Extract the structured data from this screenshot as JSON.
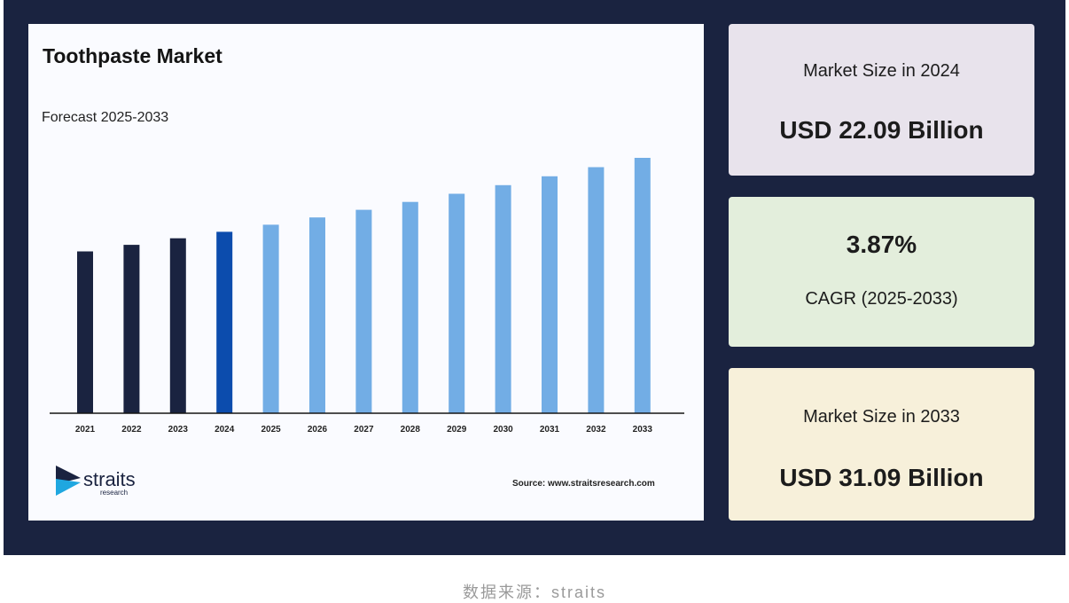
{
  "chart_data": {
    "type": "bar",
    "title": "Toothpaste Market",
    "subtitle": "Forecast 2025-2033",
    "categories": [
      "2021",
      "2022",
      "2023",
      "2024",
      "2025",
      "2026",
      "2027",
      "2028",
      "2029",
      "2030",
      "2031",
      "2032",
      "2033"
    ],
    "values": [
      19.7,
      20.5,
      21.3,
      22.09,
      22.95,
      23.84,
      24.76,
      25.72,
      26.72,
      27.76,
      28.84,
      29.96,
      31.09
    ],
    "ylim": [
      0,
      31.09
    ],
    "grid": false,
    "colors": {
      "historical": "#1a2340",
      "base_year": "#0c4cad",
      "forecast": "#72ade5"
    },
    "historical_count": 3,
    "base_year_index": 3
  },
  "panel": {
    "source": "Source: www.straitsresearch.com",
    "logo_word": "straits",
    "logo_sub": "research",
    "logo_colors": [
      "#1a2340",
      "#1fa7e0"
    ]
  },
  "cards": {
    "size_2024_label": "Market Size in 2024",
    "size_2024_value": "USD 22.09 Billion",
    "cagr_value": "3.87%",
    "cagr_label": "CAGR (2025-2033)",
    "size_2033_label": "Market Size in 2033",
    "size_2033_value": "USD 31.09 Billion"
  },
  "caption": "数据来源：straits",
  "colors": {
    "frame": "#1a2340",
    "panel": "#fafbff",
    "card_2024": "#e8e3ec",
    "card_cagr": "#e3eedc",
    "card_2033": "#f7f0da"
  }
}
